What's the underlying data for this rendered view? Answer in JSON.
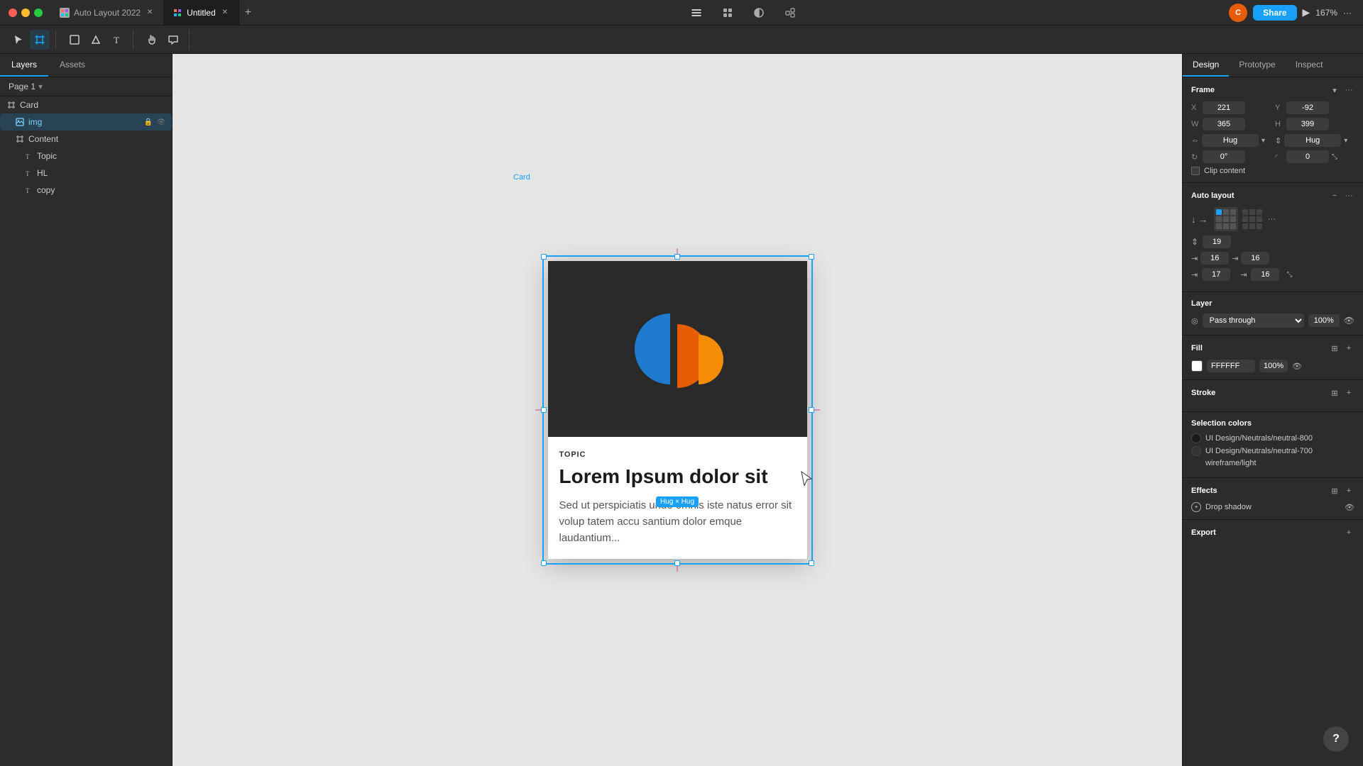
{
  "window": {
    "tabs": [
      {
        "label": "Auto Layout 2022",
        "active": false,
        "icon": "figma"
      },
      {
        "label": "Untitled",
        "active": true,
        "icon": "figma"
      }
    ],
    "zoom": "167%"
  },
  "toolbar": {
    "tools": [
      "move",
      "frame",
      "shape",
      "pen",
      "text",
      "hand",
      "comment"
    ]
  },
  "left_panel": {
    "tabs": [
      "Layers",
      "Assets"
    ],
    "page": "Page 1",
    "layers": [
      {
        "id": "card",
        "label": "Card",
        "icon": "frame",
        "indent": 0,
        "expanded": true
      },
      {
        "id": "img",
        "label": "img",
        "icon": "image",
        "indent": 1,
        "active": true
      },
      {
        "id": "content",
        "label": "Content",
        "icon": "frame",
        "indent": 1
      },
      {
        "id": "topic",
        "label": "Topic",
        "icon": "text",
        "indent": 2
      },
      {
        "id": "hl",
        "label": "HL",
        "icon": "text",
        "indent": 2
      },
      {
        "id": "copy",
        "label": "copy",
        "icon": "text",
        "indent": 2
      }
    ]
  },
  "canvas": {
    "card_label": "Card",
    "hug_label": "Hug × Hug",
    "card": {
      "image_bg": "#2a2a2a",
      "topic": "TOPIC",
      "headline": "Lorem Ipsum dolor sit",
      "copy": "Sed ut perspiciatis unde omnis iste natus error sit volup tatem accu santium dolor emque laudantium..."
    }
  },
  "right_panel": {
    "tabs": [
      "Design",
      "Prototype",
      "Inspect"
    ],
    "active_tab": "Design",
    "frame": {
      "title": "Frame",
      "x": "221",
      "y": "-92",
      "w": "365",
      "h": "399",
      "w_constraint": "Hug",
      "h_constraint": "Hug",
      "rotation": "0°",
      "corner": "0",
      "clip_content": "Clip content"
    },
    "auto_layout": {
      "title": "Auto layout",
      "gap": "19",
      "pad_top": "16",
      "pad_bottom": "17",
      "pad_left": "16",
      "pad_right": "16"
    },
    "layer": {
      "title": "Layer",
      "blend": "Pass through",
      "opacity": "100%"
    },
    "fill": {
      "title": "Fill",
      "color": "#FFFFFF",
      "hex": "FFFFFF",
      "opacity": "100%"
    },
    "stroke": {
      "title": "Stroke"
    },
    "selection_colors": {
      "title": "Selection colors",
      "colors": [
        {
          "label": "UI Design/Neutrals/neutral-800",
          "color": "#1a1a1a"
        },
        {
          "label": "UI Design/Neutrals/neutral-700",
          "color": "#333333"
        },
        {
          "label": "wireframe/light",
          "color": "#ffffff"
        }
      ]
    },
    "effects": {
      "title": "Effects",
      "items": [
        {
          "label": "Drop shadow",
          "visible": true
        }
      ]
    },
    "export": {
      "title": "Export"
    }
  }
}
